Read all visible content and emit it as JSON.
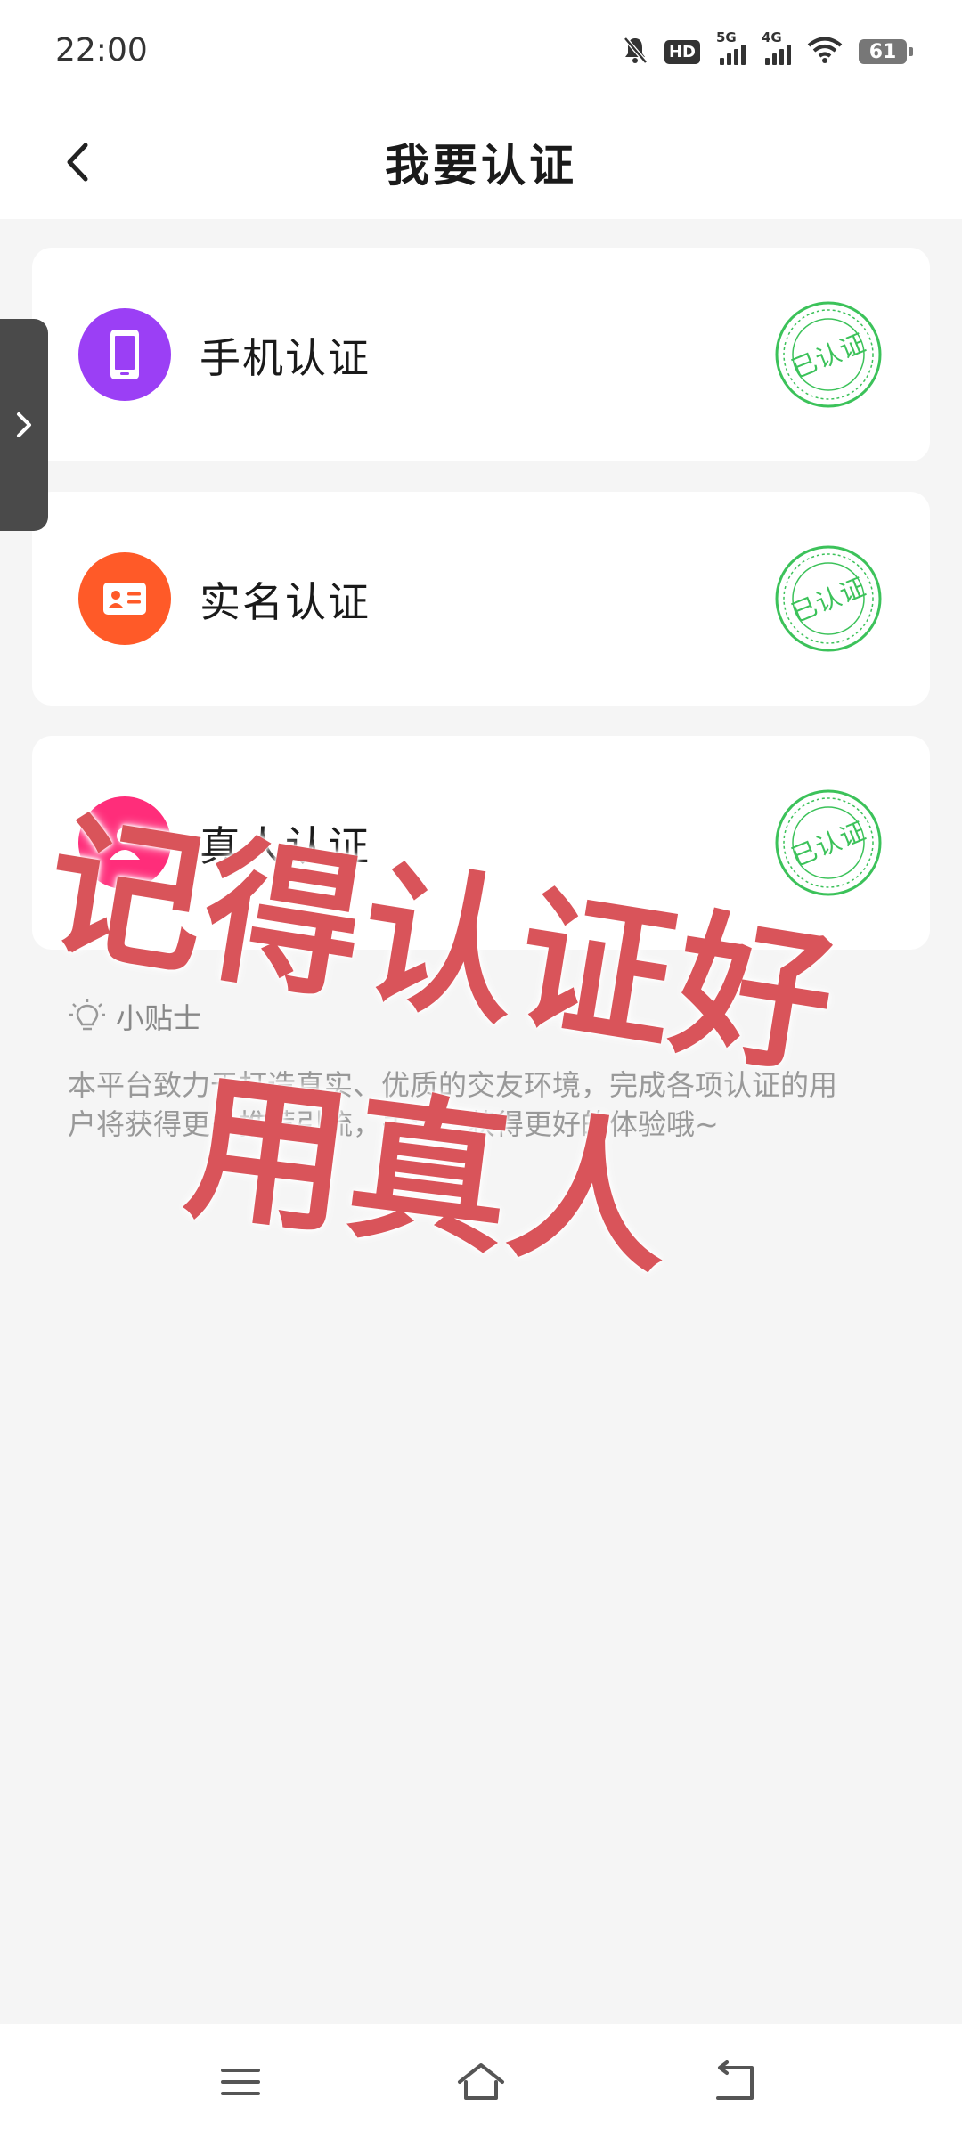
{
  "status_bar": {
    "time": "22:00",
    "hd_label": "HD",
    "sim1_label": "5G",
    "sim2_label": "4G",
    "battery": "61",
    "icons": [
      "mute-bell-icon",
      "hd-icon",
      "signal-5g-icon",
      "signal-4g-icon",
      "wifi-icon",
      "battery-icon"
    ]
  },
  "header": {
    "title": "我要认证",
    "back_icon": "chevron-left-icon"
  },
  "side_tab": {
    "icon": "chevron-right-icon"
  },
  "cards": [
    {
      "label": "手机认证",
      "icon": "phone-icon",
      "icon_color": "#9b3ff5",
      "status": "已认证"
    },
    {
      "label": "实名认证",
      "icon": "id-card-icon",
      "icon_color": "#ff5a28",
      "status": "已认证"
    },
    {
      "label": "真人认证",
      "icon": "person-icon",
      "icon_color": "#ff2d7a",
      "status": "已认证"
    }
  ],
  "tips": {
    "title": "小贴士",
    "icon": "lightbulb-icon",
    "body": "本平台致力于打造真实、优质的交友环境，完成各项认证的用户将获得更多推荐引流，关注，获得更好的体验哦~"
  },
  "watermark": {
    "line1": "记得认证好",
    "line2": "用真人",
    "color": "#d9545a"
  },
  "bottom_nav": {
    "items": [
      "menu-icon",
      "home-icon",
      "back-icon"
    ]
  },
  "colors": {
    "stamp_green": "#3cc25a",
    "background": "#f5f5f5"
  }
}
